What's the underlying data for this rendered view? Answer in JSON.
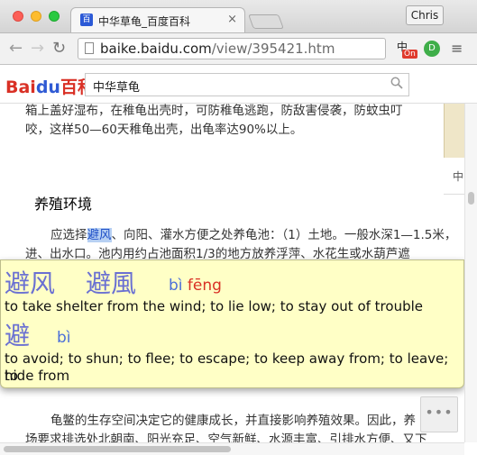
{
  "browser": {
    "tab": {
      "title": "中华草龟_百度百科",
      "close_glyph": "×"
    },
    "profile_name": "Chris",
    "url_host": "baike.baidu.com",
    "url_path": "/view/395421.htm",
    "nav_icons": {
      "back": "←",
      "forward": "→",
      "reload": "↻",
      "menu": "≡"
    },
    "extensions": {
      "dict_char": "中",
      "dict_badge": "On",
      "green_ext": "D"
    }
  },
  "site": {
    "logo_main": "Bai",
    "logo_paw": "du",
    "logo_suffix": "百科",
    "search_value": "中华草龟"
  },
  "article": {
    "line1": "箱上盖好湿布，在稚龟出壳时，可防稚龟逃跑，防敌害侵袭，防蚊虫叮",
    "line2": "咬，这样50—60天稚龟出壳，出龟率达90%以上。",
    "section_heading": "养殖环境",
    "p1_before": "应选择",
    "p1_highlight": "避风",
    "p1_after": "、向阳、灌水方便之处养龟池：（1）土地。一般水深1—1.5米，",
    "p1_line2": "进、出水口。池内用约占池面积1/3的地方放养浮萍、水花生或水葫芦遮",
    "p_bottom1": "龟鳖的生存空间决定它的健康成长，并直接影响养殖效果。因此，养",
    "p_bottom2": "场要求排选处北朝南、阳光充足、空气新鲜、水源丰富、引排水方便、又下",
    "side_label": "中"
  },
  "dictionary": {
    "entry1_simplified": "避风",
    "entry1_traditional": "避風",
    "entry1_pinyin_1": "bì",
    "entry1_pinyin_2": "fēng",
    "entry1_definition": "to take shelter from the wind; to lie low; to stay out of trouble",
    "entry2_char": "避",
    "entry2_pinyin": "bì",
    "entry2_definition_line1": "to avoid; to shun; to flee; to escape; to keep away from; to leave; to",
    "entry2_definition_line2": "hide from"
  },
  "more_button_glyph": "•••",
  "colors": {
    "headword": "#6a70d2",
    "pinyin_tone4": "#d93025",
    "popup_bg": "#ffffc6",
    "highlight_bg": "#b7d0f3"
  }
}
